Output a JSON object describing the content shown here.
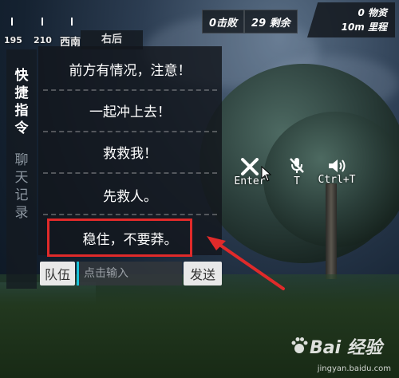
{
  "compass": {
    "headings": [
      "195",
      "210",
      "西南"
    ]
  },
  "stats": {
    "kills": "0击败",
    "remaining": "29 剩余",
    "supplies": "0 物资",
    "distance": "10m 里程"
  },
  "header_tab": "右后",
  "side_tabs": [
    {
      "label": "快捷指令",
      "active": true
    },
    {
      "label": "聊天记录",
      "active": false
    }
  ],
  "quick_commands": [
    "前方有情况，注意！",
    "一起冲上去！",
    "救救我！",
    "先救人。",
    "稳住，不要莽。"
  ],
  "chat": {
    "channel_button": "队伍",
    "input_placeholder": "点击输入",
    "send_button": "发送"
  },
  "controls": [
    {
      "icon": "close-icon",
      "key": "Enter"
    },
    {
      "icon": "mic-muted-icon",
      "key": "T"
    },
    {
      "icon": "speaker-icon",
      "key": "Ctrl+T"
    }
  ],
  "watermark": {
    "brand": "Bai 经验",
    "url": "jingyan.baidu.com"
  },
  "colors": {
    "highlight": "#e02a2a",
    "input_accent": "#19c2d8"
  }
}
